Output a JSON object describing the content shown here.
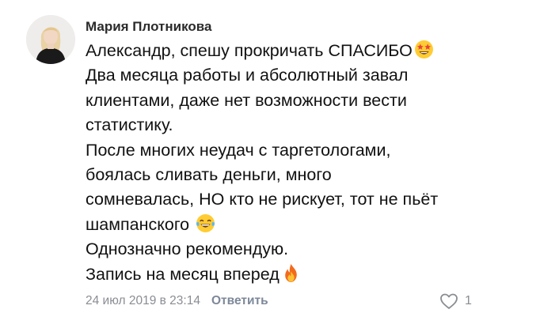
{
  "comment": {
    "author": "Мария Плотникова",
    "lines": [
      "Александр, спешу прокричать СПАСИБО",
      "Два месяца работы и абсолютный завал",
      "клиентами, даже нет возможности вести",
      "статистику.",
      "После многих неудач с таргетологами,",
      "боялась сливать деньги, много",
      "сомневалась, НО кто не рискует, тот не пьёт",
      "шампанского",
      "Однозначно рекомендую.",
      "Запись на месяц вперед"
    ],
    "emojis": {
      "line_0": "star-struck-emoji",
      "line_7": "tears-of-joy-emoji",
      "line_9": "fire-emoji"
    },
    "date": "24 июл 2019 в 23:14",
    "reply_label": "Ответить",
    "like_icon": "heart-outline-icon",
    "like_count": "1"
  },
  "colors": {
    "author": "#2b2b2b",
    "text": "#111111",
    "date": "#8a8d93",
    "reply": "#7d8899"
  }
}
